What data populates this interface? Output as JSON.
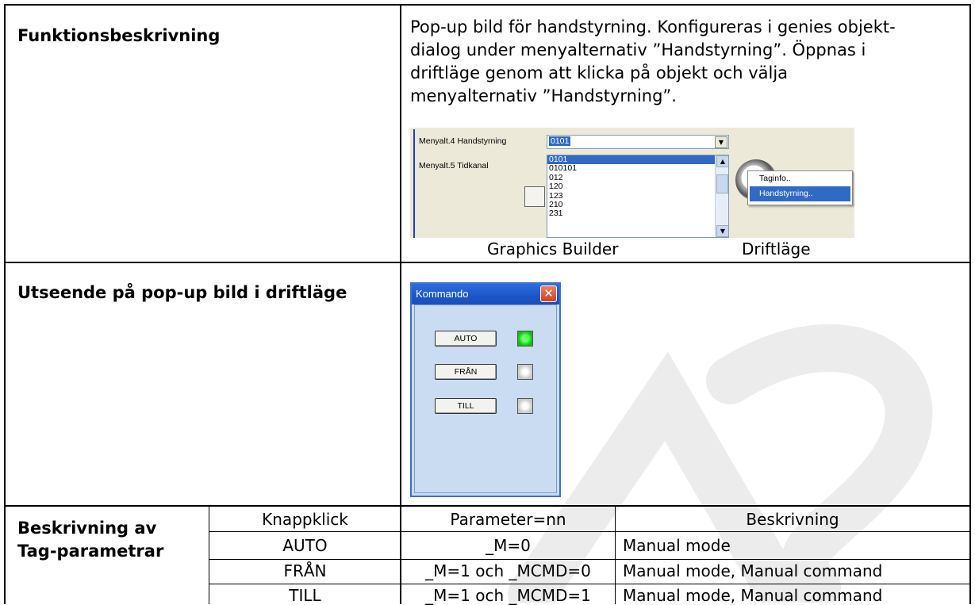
{
  "row1": {
    "heading": "Funktionsbeskrivning",
    "description_lines": [
      "Pop-up bild för handstyrning. Konfigureras i genies objekt-",
      "dialog under menyalternativ ”Handstyrning”. Öppnas i",
      "driftläge genom att klicka på objekt och välja",
      "menyalternativ ”Handstyrning”."
    ],
    "screenshot": {
      "menu4_label": "Menyalt.4 Handstyrning",
      "menu5_label": "Menyalt.5 Tidkanal",
      "combo_value": "0101",
      "dropdown_items": [
        "0101",
        "010101",
        "012",
        "120",
        "123",
        "210",
        "231"
      ],
      "context_menu": [
        "Taginfo..",
        "Handstyrning.."
      ]
    },
    "caption_left": "Graphics Builder",
    "caption_right": "Driftläge"
  },
  "row2": {
    "heading": "Utseende på pop-up bild i driftläge",
    "popup": {
      "title": "Kommando",
      "close_glyph": "✕",
      "buttons": [
        {
          "label": "AUTO",
          "led": "on"
        },
        {
          "label": "FRÅN",
          "led": "off"
        },
        {
          "label": "TILL",
          "led": "off"
        }
      ]
    }
  },
  "row3": {
    "heading_line1": "Beskrivning av",
    "heading_line2": "Tag-parametrar",
    "headers": [
      "Knappklick",
      "Parameter=nn",
      "Beskrivning"
    ],
    "rows": [
      [
        "AUTO",
        "_M=0",
        "Manual mode"
      ],
      [
        "FRÅN",
        "_M=1 och _MCMD=0",
        "Manual mode, Manual command"
      ],
      [
        "TILL",
        "_M=1 och _MCMD=1",
        "Manual mode, Manual command"
      ]
    ]
  },
  "colors": {
    "titlebar": "#1c55c8",
    "popup_bg": "#c9dcf2",
    "led_on": "#10c010",
    "highlight": "#316ac5"
  }
}
